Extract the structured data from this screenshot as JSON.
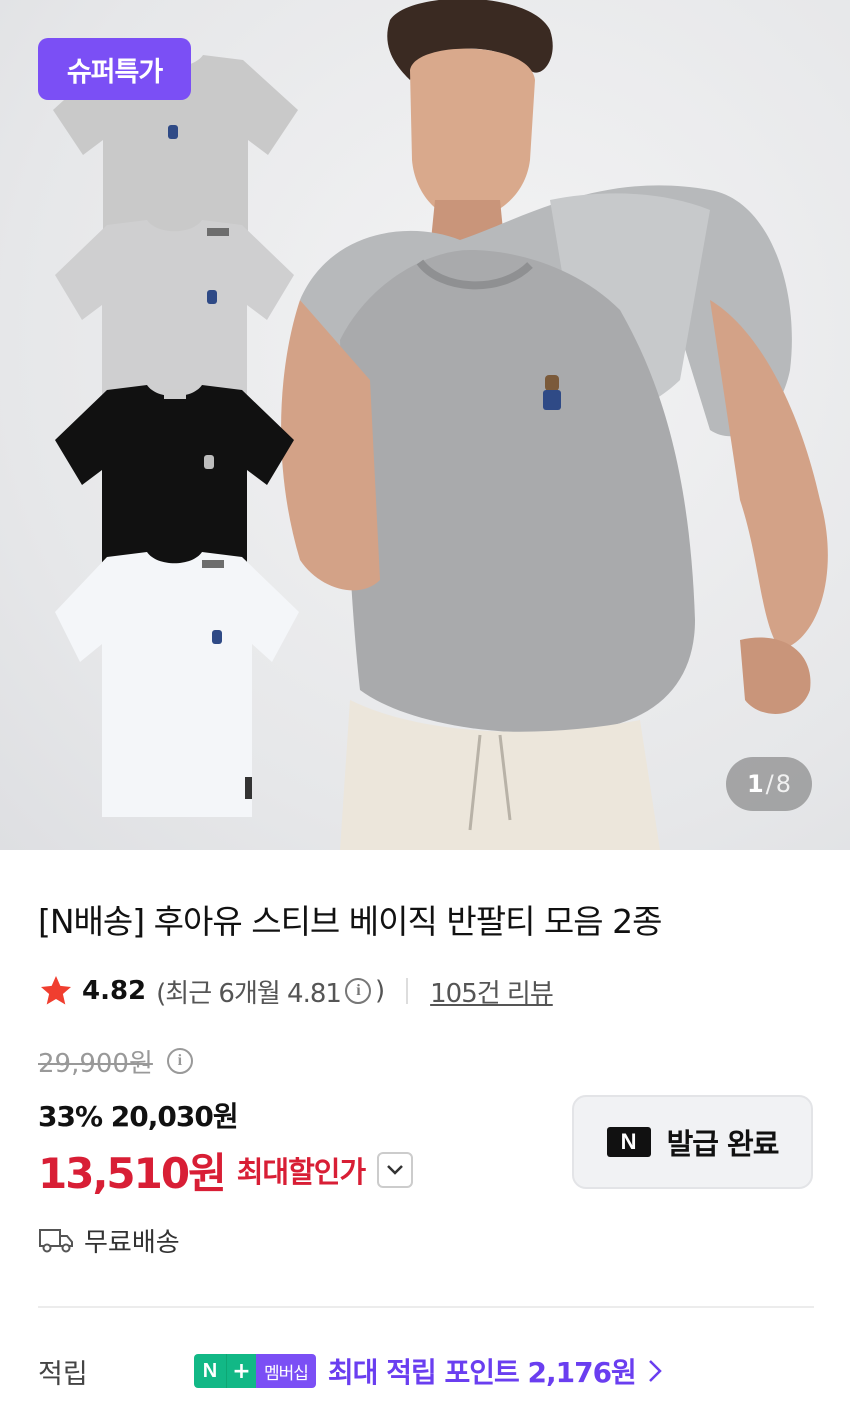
{
  "gallery": {
    "badge": "슈퍼특가",
    "counter_current": "1",
    "counter_sep": "/",
    "counter_total": "8",
    "thumb_colors": [
      "#c9c9c9",
      "#cfcfd0",
      "#111111",
      "#f4f6f9"
    ],
    "model_shirt_color": "#a9aaac"
  },
  "product": {
    "title": "[N배송] 후아유 스티브 베이직 반팔티 모음 2종"
  },
  "rating": {
    "score": "4.82",
    "recent": "(최근 6개월 4.81",
    "recent_close": ")",
    "info_glyph": "i",
    "reviews": "105건 리뷰",
    "star_color": "#f03e2f"
  },
  "price": {
    "original": "29,900원",
    "info_glyph": "i",
    "discount_line": "33% 20,030원",
    "final": "13,510원",
    "final_label": "최대할인가",
    "accent_color": "#d81e35"
  },
  "coupon": {
    "logo": "N",
    "label": "발급 완료"
  },
  "shipping": {
    "text": "무료배송"
  },
  "points": {
    "label": "적립",
    "badge_n": "N",
    "badge_plus": "+",
    "badge_member": "멤버십",
    "text": "최대 적립 포인트 2,176원"
  }
}
